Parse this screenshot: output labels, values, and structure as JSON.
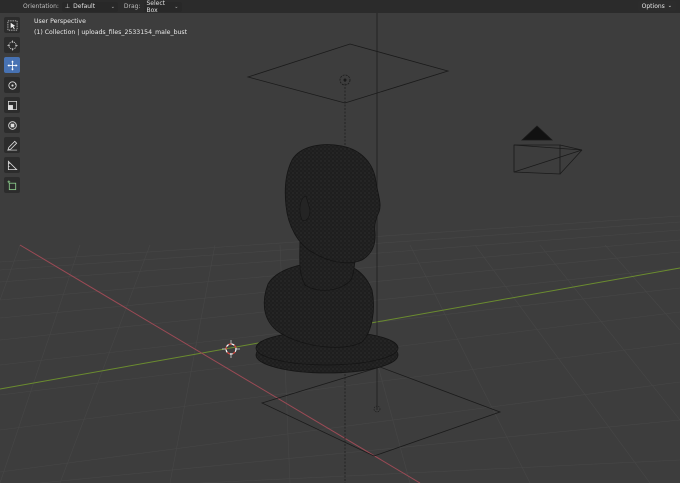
{
  "header": {
    "orientation_label": "Orientation:",
    "orientation_value": "Default",
    "drag_label": "Drag:",
    "drag_value": "Select Box",
    "options_label": "Options"
  },
  "viewport": {
    "perspective": "User Perspective",
    "collection": "(1) Collection | uploads_files_2533154_male_bust"
  },
  "toolbar": {
    "tools": [
      {
        "name": "select-box-tool",
        "icon": "select-icon",
        "active": false
      },
      {
        "name": "cursor-tool",
        "icon": "cursor-icon",
        "active": false
      },
      {
        "name": "move-tool",
        "icon": "move-icon",
        "active": true
      },
      {
        "name": "rotate-tool",
        "icon": "rotate-icon",
        "active": false
      },
      {
        "name": "scale-tool",
        "icon": "scale-icon",
        "active": false
      },
      {
        "name": "transform-tool",
        "icon": "transform-icon",
        "active": false
      },
      {
        "name": "annotate-tool",
        "icon": "annotate-icon",
        "active": false
      },
      {
        "name": "measure-tool",
        "icon": "measure-icon",
        "active": false
      },
      {
        "name": "add-cube-tool",
        "icon": "add-cube-icon",
        "active": false
      }
    ]
  },
  "colors": {
    "background": "#3d3d3d",
    "grid": "#4a4a4a",
    "x_axis": "#9b4a55",
    "y_axis": "#6b8c2f",
    "active_tool": "#4772b3",
    "object_outline": "#1b1b1b"
  }
}
